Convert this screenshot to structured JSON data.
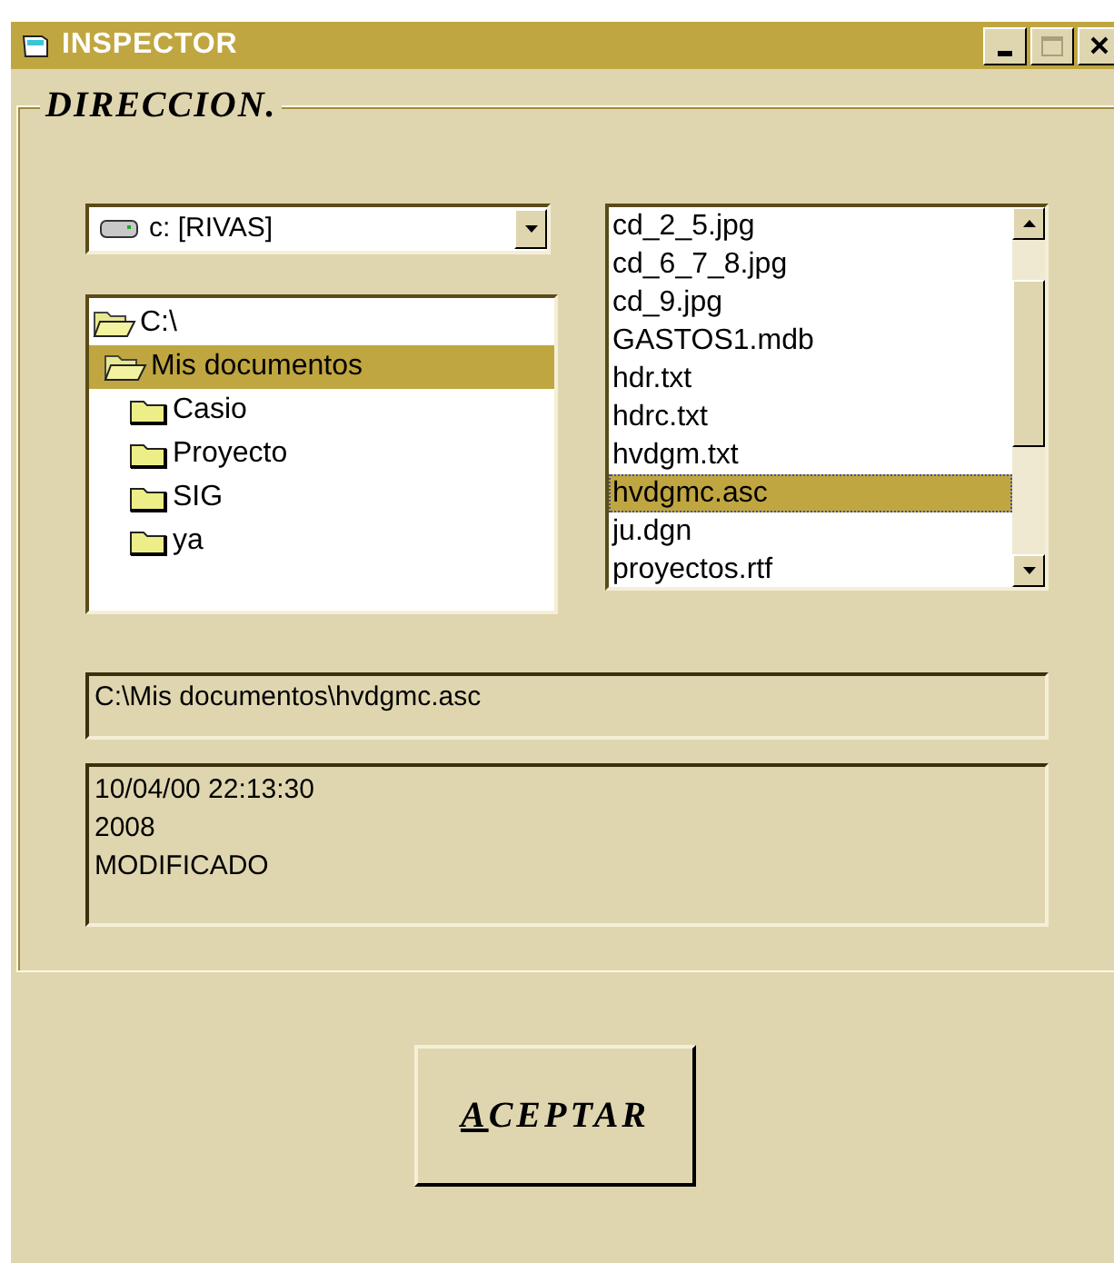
{
  "window": {
    "title": "INSPECTOR"
  },
  "frame": {
    "label": "DIRECCION."
  },
  "drive": {
    "value": "c: [RIVAS]"
  },
  "folders": [
    {
      "label": "C:\\",
      "expanded": true,
      "selected": false,
      "children": [
        {
          "label": "Mis documentos",
          "expanded": true,
          "selected": true,
          "children": [
            {
              "label": "Casio",
              "expanded": false,
              "selected": false
            },
            {
              "label": "Proyecto",
              "expanded": false,
              "selected": false
            },
            {
              "label": "SIG",
              "expanded": false,
              "selected": false
            },
            {
              "label": "ya",
              "expanded": false,
              "selected": false
            }
          ]
        }
      ]
    }
  ],
  "files": [
    {
      "label": "cd_2_5.jpg",
      "selected": false
    },
    {
      "label": "cd_6_7_8.jpg",
      "selected": false
    },
    {
      "label": "cd_9.jpg",
      "selected": false
    },
    {
      "label": "GASTOS1.mdb",
      "selected": false
    },
    {
      "label": "hdr.txt",
      "selected": false
    },
    {
      "label": "hdrc.txt",
      "selected": false
    },
    {
      "label": "hvdgm.txt",
      "selected": false
    },
    {
      "label": "hvdgmc.asc",
      "selected": true
    },
    {
      "label": "ju.dgn",
      "selected": false
    },
    {
      "label": "proyectos.rtf",
      "selected": false
    }
  ],
  "path": {
    "value": "C:\\Mis documentos\\hvdgmc.asc"
  },
  "info": {
    "lines": [
      "10/04/00 22:13:30",
      "2008",
      "MODIFICADO"
    ]
  },
  "button": {
    "label": "ACEPTAR",
    "underline_first": true
  }
}
